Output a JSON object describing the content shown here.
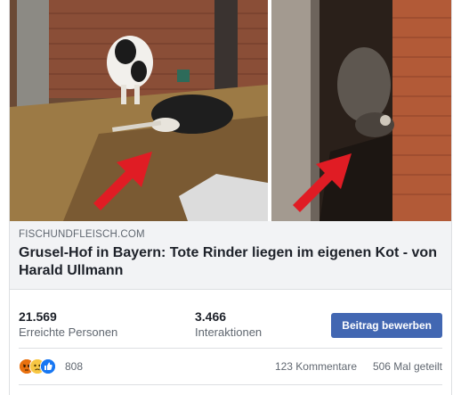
{
  "post": {
    "image_alt": "Zwei Stallfotos mit toten Rindern, rote Pfeile",
    "domain": "FISCHUNDFLEISCH.COM",
    "headline": "Grusel-Hof in Bayern: Tote Rinder liegen im eigenen Kot - von Harald Ullmann"
  },
  "insights": {
    "reach_value": "21.569",
    "reach_label": "Erreichte Personen",
    "engagement_value": "3.466",
    "engagement_label": "Interaktionen",
    "boost_label": "Beitrag bewerben"
  },
  "reactions": {
    "icons": [
      "angry-icon",
      "sad-icon",
      "like-icon"
    ],
    "count": "808",
    "comments": "123 Kommentare",
    "shares": "506 Mal geteilt"
  },
  "colors": {
    "brand_blue": "#4267b2",
    "arrow_red": "#e01c24",
    "meta_gray": "#606770"
  }
}
